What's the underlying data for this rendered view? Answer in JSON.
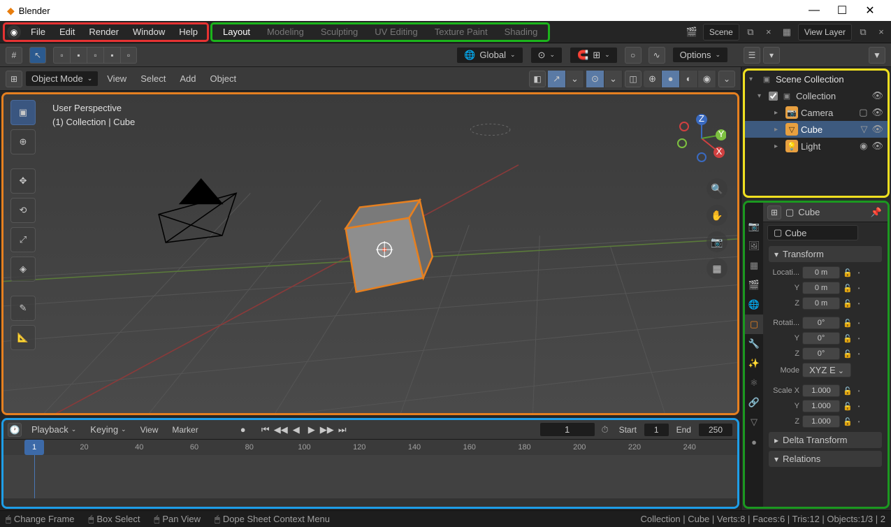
{
  "window": {
    "title": "Blender"
  },
  "menu": {
    "file": "File",
    "edit": "Edit",
    "render": "Render",
    "window": "Window",
    "help": "Help"
  },
  "workspaces": [
    "Layout",
    "Modeling",
    "Sculpting",
    "UV Editing",
    "Texture Paint",
    "Shading"
  ],
  "scene": {
    "label": "Scene"
  },
  "viewlayer": {
    "label": "View Layer"
  },
  "transform_orientation": "Global",
  "options_label": "Options",
  "mode": "Object Mode",
  "viewport_menus": {
    "view": "View",
    "select": "Select",
    "add": "Add",
    "object": "Object"
  },
  "viewport_info": {
    "line1": "User Perspective",
    "line2": "(1) Collection | Cube"
  },
  "gizmo_axes": {
    "x": "X",
    "y": "Y",
    "z": "Z"
  },
  "timeline": {
    "playback": "Playback",
    "keying": "Keying",
    "view": "View",
    "marker": "Marker",
    "current": "1",
    "start_label": "Start",
    "start": "1",
    "end_label": "End",
    "end": "250",
    "ticks": [
      "20",
      "40",
      "60",
      "80",
      "100",
      "120",
      "140",
      "160",
      "180",
      "200",
      "220",
      "240"
    ]
  },
  "outliner": {
    "root": "Scene Collection",
    "collection": "Collection",
    "items": [
      {
        "name": "Camera",
        "type": "camera"
      },
      {
        "name": "Cube",
        "type": "mesh",
        "selected": true
      },
      {
        "name": "Light",
        "type": "light"
      }
    ]
  },
  "properties": {
    "header": "Cube",
    "crumb": "Cube",
    "transform_label": "Transform",
    "location": {
      "label": "Locati...",
      "y": "Y",
      "z": "Z",
      "values": [
        "0 m",
        "0 m",
        "0 m"
      ]
    },
    "rotation": {
      "label": "Rotati...",
      "y": "Y",
      "z": "Z",
      "values": [
        "0°",
        "0°",
        "0°"
      ],
      "mode_label": "Mode",
      "mode": "XYZ E"
    },
    "scale": {
      "label": "Scale X",
      "y": "Y",
      "z": "Z",
      "values": [
        "1.000",
        "1.000",
        "1.000"
      ]
    },
    "delta": "Delta Transform",
    "relations": "Relations"
  },
  "status": {
    "change_frame": "Change Frame",
    "box_select": "Box Select",
    "pan_view": "Pan View",
    "context_menu": "Dope Sheet Context Menu",
    "stats": "Collection | Cube | Verts:8 | Faces:6 | Tris:12 | Objects:1/3 | 2"
  }
}
